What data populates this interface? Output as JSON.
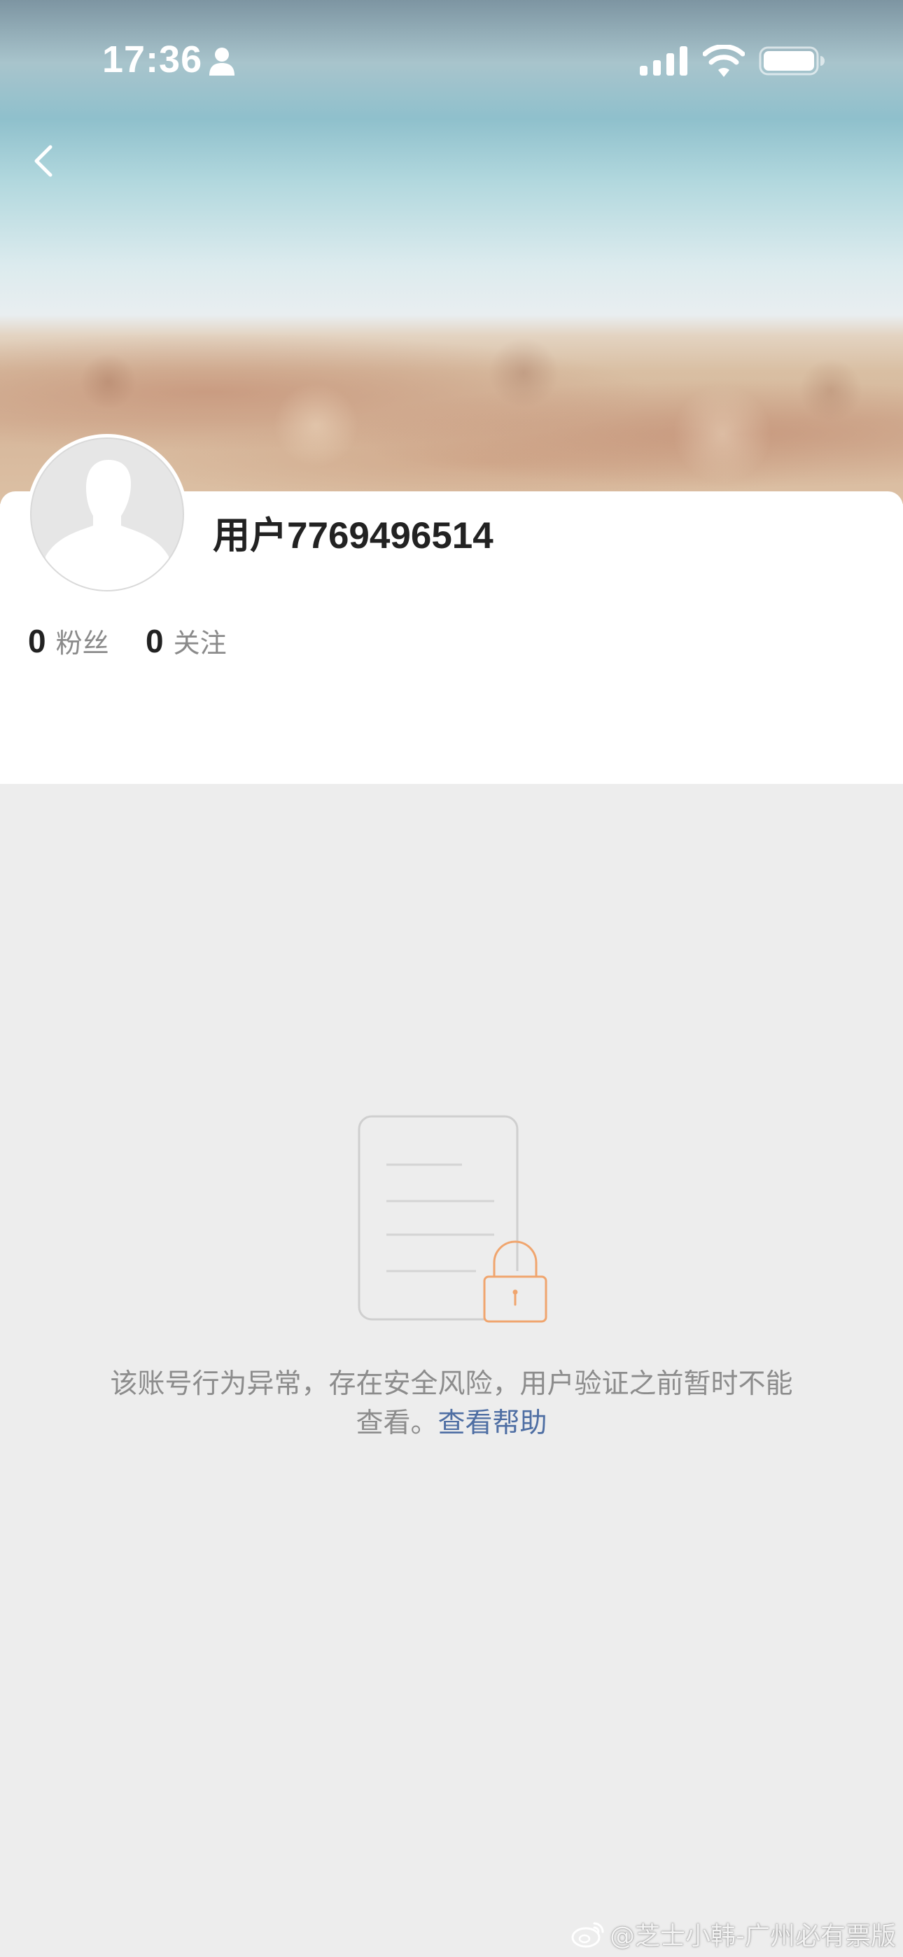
{
  "status_bar": {
    "time": "17:36",
    "icons": [
      "person-icon",
      "cellular-signal-icon",
      "wifi-icon",
      "battery-icon"
    ]
  },
  "header": {
    "back_icon": "chevron-left-icon"
  },
  "profile": {
    "username": "用户7769496514",
    "avatar_icon": "default-avatar-silhouette",
    "followers": {
      "count": "0",
      "label": "粉丝"
    },
    "following": {
      "count": "0",
      "label": "关注"
    }
  },
  "notice": {
    "illustration_icon": "locked-document-icon",
    "line1": "该账号行为异常，存在安全风险，用户验证之前暂时不能",
    "line2_prefix": "查看。",
    "help_link": "查看帮助"
  },
  "watermark": {
    "logo_icon": "weibo-logo-icon",
    "text": "@芝士小韩-广州必有票版"
  },
  "colors": {
    "page_background": "#ededed",
    "card_background": "#ffffff",
    "primary_text": "#222222",
    "secondary_text": "#8c8c8c",
    "link": "#4e6ea3",
    "lock_accent": "#f0a56e",
    "document_outline": "#cfcfcf"
  }
}
